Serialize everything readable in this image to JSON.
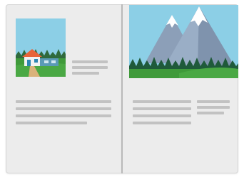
{
  "book": {
    "left_page": {
      "illustration": "house-landscape-illustration",
      "text_blocks": [
        "caption-placeholder",
        "paragraph-placeholder"
      ]
    },
    "right_page": {
      "illustration": "mountain-landscape-illustration",
      "text_blocks": [
        "paragraph-placeholder",
        "caption-placeholder"
      ]
    }
  },
  "colors": {
    "page": "#ececec",
    "spine": "#b9b9b9",
    "text_line": "#c2c2c2",
    "sky": "#8ccfe6",
    "grass": "#3f9a3a",
    "trees": "#1f5a3a",
    "mountain": "#8c9fb8",
    "snow": "#ffffff",
    "roof": "#e8643a",
    "house": "#f2f2f2"
  }
}
